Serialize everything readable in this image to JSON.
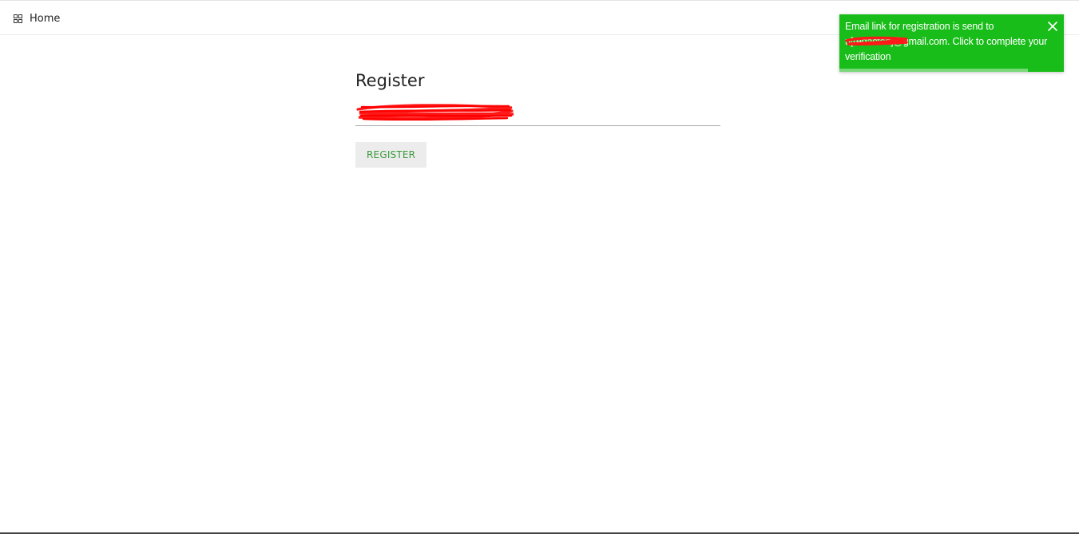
{
  "nav": {
    "home_label": "Home",
    "home_icon": "grid-icon"
  },
  "register": {
    "title": "Register",
    "email_value": "[redacted]",
    "button_label": "REGISTER",
    "button_color": "#3c9a3c"
  },
  "toast": {
    "message": "Email link for registration is send to u[redacted]@gmail.com. Click to complete your verification",
    "background": "#19bd19",
    "close_icon": "close-icon",
    "progress_remaining": 0.84
  }
}
